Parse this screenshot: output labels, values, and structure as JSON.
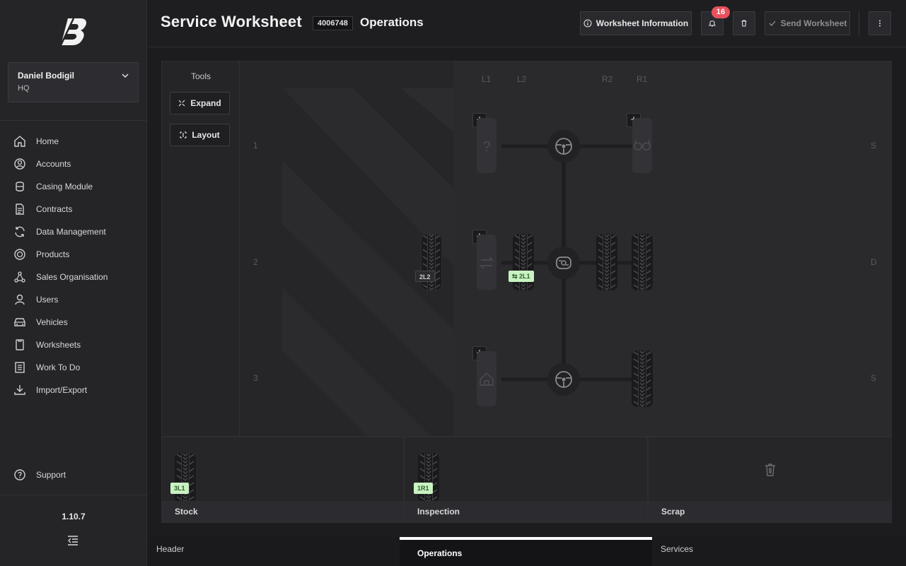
{
  "app": {
    "version": "1.10.7"
  },
  "user": {
    "name": "Daniel Bodigil",
    "org": "HQ"
  },
  "nav": [
    {
      "label": "Home",
      "icon": "home-icon"
    },
    {
      "label": "Accounts",
      "icon": "account-icon"
    },
    {
      "label": "Casing Module",
      "icon": "casing-icon"
    },
    {
      "label": "Contracts",
      "icon": "contract-icon"
    },
    {
      "label": "Data Management",
      "icon": "sync-icon"
    },
    {
      "label": "Products",
      "icon": "product-icon"
    },
    {
      "label": "Sales Organisation",
      "icon": "organisation-icon"
    },
    {
      "label": "Users",
      "icon": "user-icon"
    },
    {
      "label": "Vehicles",
      "icon": "vehicle-icon"
    },
    {
      "label": "Worksheets",
      "icon": "worksheet-icon"
    },
    {
      "label": "Work To Do",
      "icon": "checklist-icon"
    },
    {
      "label": "Import/Export",
      "icon": "download-icon"
    }
  ],
  "support_label": "Support",
  "header": {
    "title": "Service Worksheet",
    "worksheet_id": "4006748",
    "subtitle": "Operations",
    "info_button": "Worksheet Information",
    "notification_count": "16",
    "send_button": "Send Worksheet"
  },
  "tools": {
    "title": "Tools",
    "expand": "Expand",
    "layout": "Layout"
  },
  "axle_layout": {
    "positions": [
      "L1",
      "L2",
      "R2",
      "R1"
    ],
    "axles": [
      {
        "number": "1",
        "type": "S"
      },
      {
        "number": "2",
        "type": "D"
      },
      {
        "number": "3",
        "type": "S"
      }
    ],
    "tyre_tags": {
      "staging": "2L2",
      "mounted": "2L1"
    }
  },
  "bins": [
    {
      "label": "Stock",
      "tag": "3L1"
    },
    {
      "label": "Inspection",
      "tag": "1R1"
    },
    {
      "label": "Scrap",
      "tag": ""
    }
  ],
  "tabs": {
    "header": "Header",
    "operations": "Operations",
    "services": "Services"
  },
  "colors": {
    "accent_badge": "#e8505b",
    "tag_green": "#c9f1c2",
    "background": "#1c1c1f"
  }
}
